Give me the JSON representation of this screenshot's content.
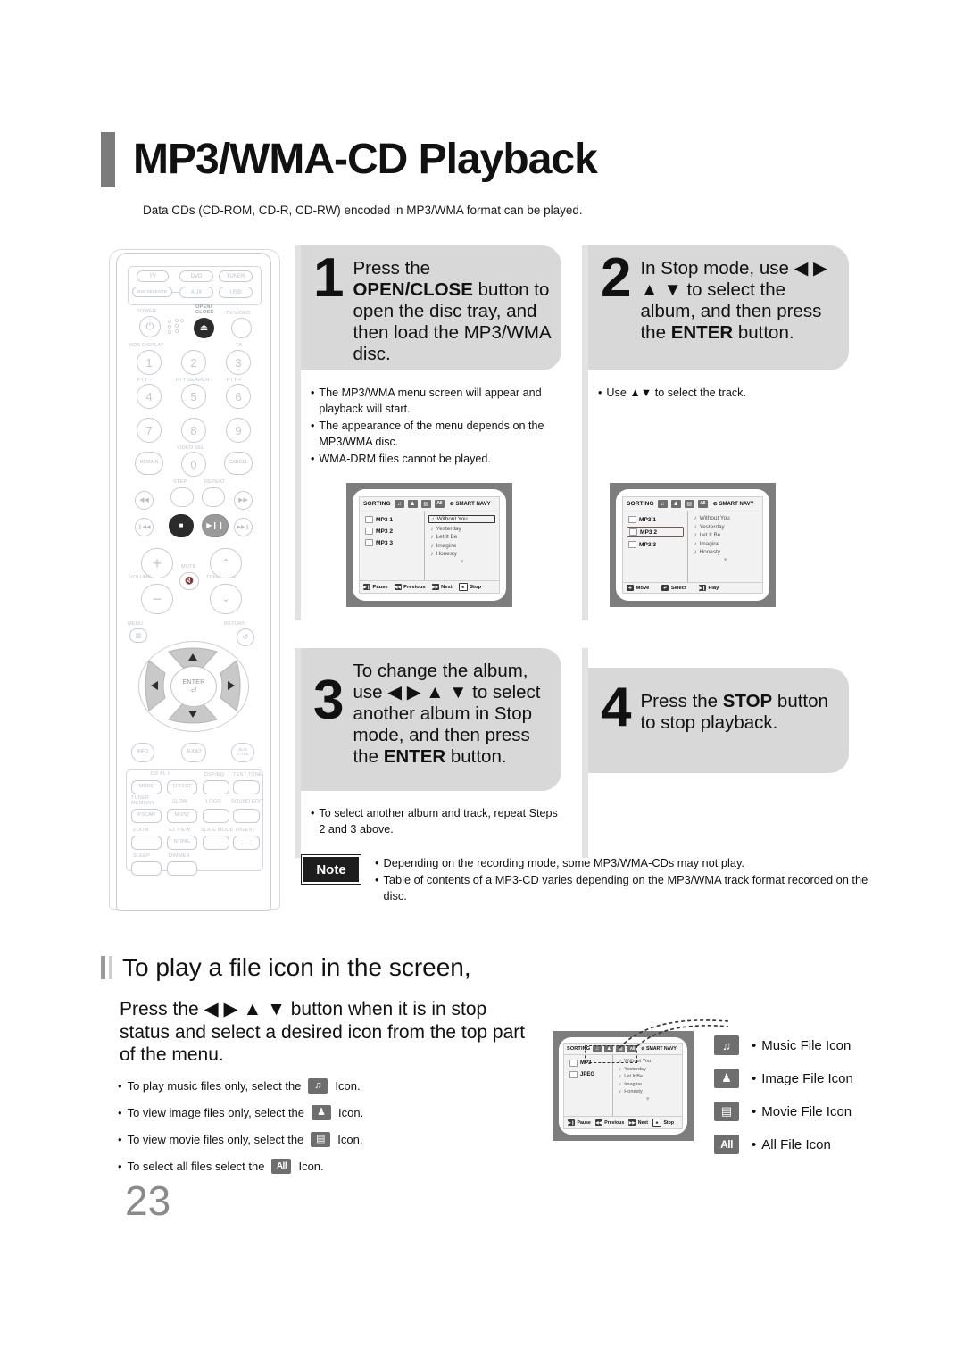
{
  "header": {
    "title": "MP3/WMA-CD Playback",
    "subtitle": "Data CDs (CD-ROM, CD-R, CD-RW) encoded in MP3/WMA format can be played."
  },
  "steps": [
    {
      "number": "1",
      "text_parts": [
        "Press the ",
        "OPEN/CLOSE",
        " button to open the disc tray, and then load the MP3/WMA disc."
      ],
      "bullets": [
        "The MP3/WMA menu screen will appear and playback will start.",
        "The appearance of the menu depends on the MP3/WMA disc.",
        "WMA-DRM files cannot be played."
      ]
    },
    {
      "number": "2",
      "text_parts": [
        "In Stop mode, use ",
        "◀ ▶ ▲ ▼",
        " to select the album, and then press the ",
        "ENTER",
        " button."
      ],
      "bullets": [
        "Use ▲▼ to select the track."
      ]
    },
    {
      "number": "3",
      "text_parts": [
        "To change the album, use ",
        "◀ ▶ ▲ ▼",
        " to select another album in Stop mode, and then press the ",
        "ENTER",
        " button."
      ],
      "bullets": [
        "To select another album and track, repeat Steps 2 and 3 above."
      ]
    },
    {
      "number": "4",
      "text_parts": [
        "Press the ",
        "STOP",
        " button to stop playback."
      ],
      "bullets": []
    }
  ],
  "screens": {
    "sorting_label": "SORTING",
    "smart_navy": "SMART NAVY",
    "icons": [
      "music-note",
      "person",
      "film",
      "All"
    ],
    "screen1": {
      "folders": [
        {
          "label": "MP3 1",
          "selected": false
        },
        {
          "label": "MP3 2",
          "selected": false
        },
        {
          "label": "MP3 3",
          "selected": false
        }
      ],
      "tracks": [
        {
          "label": "Without You",
          "selected": true
        },
        {
          "label": "Yesterday",
          "selected": false
        },
        {
          "label": "Let It Be",
          "selected": false
        },
        {
          "label": "Imagine",
          "selected": false
        },
        {
          "label": "Honesty",
          "selected": false
        }
      ],
      "footer": [
        {
          "key": "▶❙",
          "label": "Pause"
        },
        {
          "key": "◀◀",
          "label": "Previous"
        },
        {
          "key": "▶▶",
          "label": "Next"
        },
        {
          "key": "■",
          "label": "Stop"
        }
      ]
    },
    "screen2": {
      "folders": [
        {
          "label": "MP3 1",
          "selected": false
        },
        {
          "label": "MP3 2",
          "selected": true
        },
        {
          "label": "MP3 3",
          "selected": false
        }
      ],
      "tracks": [
        {
          "label": "Without You",
          "selected": false
        },
        {
          "label": "Yesterday",
          "selected": false
        },
        {
          "label": "Let It Be",
          "selected": false
        },
        {
          "label": "Imagine",
          "selected": false
        },
        {
          "label": "Honesty",
          "selected": false
        }
      ],
      "footer": [
        {
          "key": "✛",
          "label": "Move"
        },
        {
          "key": "↵",
          "label": "Select"
        },
        {
          "key": "▶❙",
          "label": "Play"
        }
      ]
    },
    "screen3": {
      "folders": [
        {
          "label": "MP3",
          "selected": false
        },
        {
          "label": "JPEG",
          "selected": false
        }
      ],
      "tracks": [
        {
          "label": "Without You",
          "selected": false
        },
        {
          "label": "Yesterday",
          "selected": false
        },
        {
          "label": "Let It Be",
          "selected": false
        },
        {
          "label": "Imagine",
          "selected": false
        },
        {
          "label": "Honesty",
          "selected": false
        }
      ],
      "footer": [
        {
          "key": "▶❙",
          "label": "Pause"
        },
        {
          "key": "◀◀",
          "label": "Previous"
        },
        {
          "key": "▶▶",
          "label": "Next"
        },
        {
          "key": "■",
          "label": "Stop"
        }
      ]
    }
  },
  "note": {
    "badge": "Note",
    "items": [
      "Depending on the recording mode, some MP3/WMA-CDs may not play.",
      "Table of contents of a MP3-CD varies depending on the MP3/WMA track format recorded on the disc."
    ]
  },
  "section2": {
    "title": "To play a file icon in the screen,",
    "paragraph": "Press the ◀ ▶ ▲ ▼ button when it is in stop status and select a desired icon from the top part of the menu.",
    "bullets": [
      {
        "before": "To play music files only, select the",
        "icon": "music-note",
        "after": "Icon."
      },
      {
        "before": "To view image files only, select the",
        "icon": "person",
        "after": "Icon."
      },
      {
        "before": "To view movie files only, select the",
        "icon": "film",
        "after": "Icon."
      },
      {
        "before": "To select all files select the",
        "icon": "All",
        "after": "Icon."
      }
    ],
    "legend": [
      {
        "icon": "music-note",
        "label": "Music File Icon"
      },
      {
        "icon": "person",
        "label": "Image File Icon"
      },
      {
        "icon": "film",
        "label": "Movie File Icon"
      },
      {
        "icon": "All",
        "label": "All File Icon"
      }
    ]
  },
  "remote": {
    "source_buttons": [
      "TV",
      "DVD",
      "TUNER",
      "DVD RECEIVER",
      "AUX",
      "USB"
    ],
    "labels": {
      "power": "POWER",
      "open_close": "OPEN/\nCLOSE",
      "tv_video": "TV/VIDEO",
      "rds_display": "RDS DISPLAY",
      "ta": "TA",
      "pty_minus": "PTY -",
      "pty_search": "PTY SEARCH",
      "pty_plus": "PTY +",
      "video_sel": "VIDEO SEL",
      "remain": "REMAIN",
      "cancel": "CANCEL",
      "step": "STEP",
      "repeat": "REPEAT",
      "volume": "VOLUME",
      "mute": "MUTE",
      "tuning_ch": "TUNING/CH",
      "menu": "MENU",
      "return": "RETURN",
      "enter": "ENTER",
      "info": "INFO",
      "audio": "AUDIO",
      "subtitle": "SUB\nTITLE",
      "dd_pl2": "DD PL II",
      "mode": "MODE",
      "effect": "EFFECT",
      "dsp_eq": "DSP/EQ",
      "test_tone": "TEST TONE",
      "tuner_memory": "TUNER\nMEMORY",
      "slow": "SLOW",
      "logo": "LOGO",
      "sound_edit": "SOUND EDIT",
      "p_scan": "P.SCAN",
      "mo_st": "MO/ST",
      "zoom": "ZOOM",
      "ez_view": "EZ VIEW",
      "slide_mode": "SLIDE MODE",
      "digest": "DIGEST",
      "nt_pal": "NT/PAL",
      "sleep": "SLEEP",
      "dimmer": "DIMMER"
    },
    "numbers": [
      "1",
      "2",
      "3",
      "4",
      "5",
      "6",
      "7",
      "8",
      "9",
      "0"
    ]
  },
  "page_number": "23"
}
